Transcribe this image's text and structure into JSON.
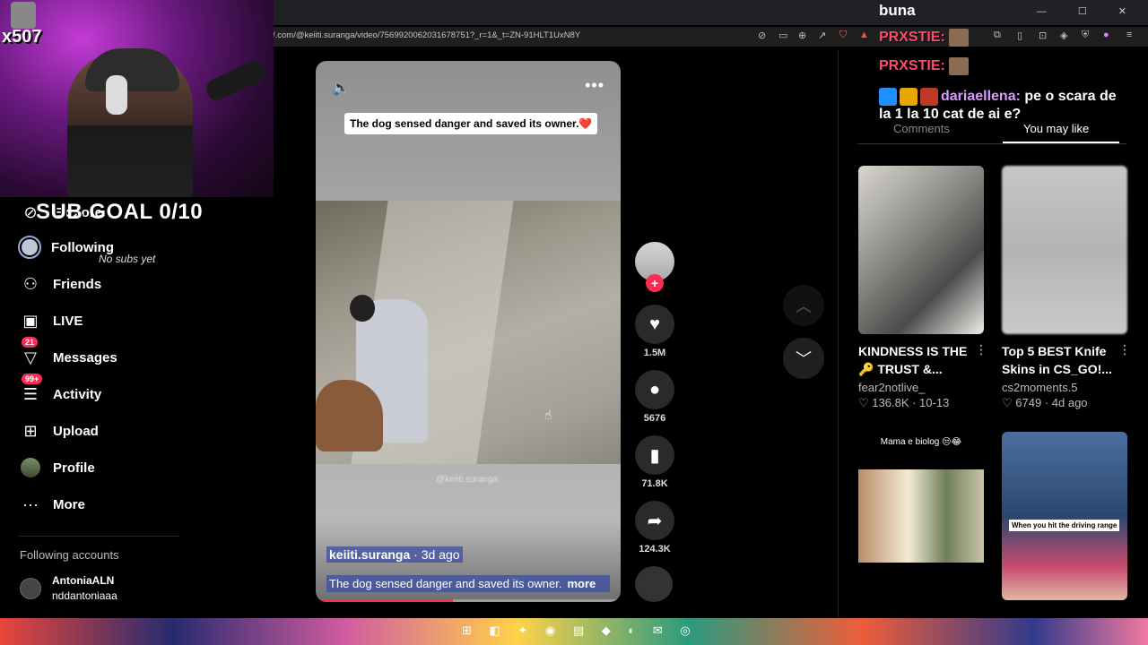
{
  "window": {
    "title": "buna",
    "controls": "— ☐ ✕"
  },
  "browser": {
    "url": "/.com/@keiiti.suranga/video/7569920062031678751?_r=1&_t=ZN-91HLT1UxN8Y"
  },
  "stream": {
    "viewer_badge": "x507",
    "sub_goal": "SUB GOAL 0/10",
    "no_subs": "No subs yet"
  },
  "sidebar": {
    "items": [
      {
        "label": "Explore",
        "icon": "compass-icon"
      },
      {
        "label": "Following",
        "icon": "following-icon"
      },
      {
        "label": "Friends",
        "icon": "friends-icon"
      },
      {
        "label": "LIVE",
        "icon": "live-icon"
      },
      {
        "label": "Messages",
        "icon": "messages-icon",
        "badge": "21"
      },
      {
        "label": "Activity",
        "icon": "activity-icon",
        "badge": "99+"
      },
      {
        "label": "Upload",
        "icon": "upload-icon"
      },
      {
        "label": "Profile",
        "icon": "profile-icon"
      },
      {
        "label": "More",
        "icon": "more-icon"
      }
    ],
    "following_header": "Following accounts",
    "account": {
      "name": "AntoniaALN",
      "handle": "nddantoniaaa"
    }
  },
  "video": {
    "overlay_caption": "The dog sensed danger and saved its owner.❤️",
    "watermark": "@keiiti.suranga",
    "author": "keiiti.suranga",
    "posted": " · 3d ago",
    "caption": "The dog sensed danger and saved its owner.",
    "more": "more",
    "progress": 0.45
  },
  "actions": {
    "likes": "1.5M",
    "comments": "5676",
    "saves": "71.8K",
    "shares": "124.3K"
  },
  "panel": {
    "tab_comments": "Comments",
    "tab_may_like": "You may like",
    "cards": [
      {
        "title": "KINDNESS IS THE 🔑 TRUST &...",
        "author": "fear2notlive_",
        "likes": "136.8K",
        "date": "10-13"
      },
      {
        "title": "Top 5 BEST Knife Skins in CS_GO!...",
        "author": "cs2moments.5",
        "likes": "6749",
        "date": "4d ago"
      },
      {
        "thumb_text": "Mama e biolog 😒😂"
      },
      {
        "thumb_text": "When you hit the driving range"
      }
    ]
  },
  "chat": {
    "line1_user": "PRXSTIE:",
    "line2_user": "PRXSTIE:",
    "line3_user": "dariaellena:",
    "line3_text": " pe o scara de la 1 la 10 cat de ai e?"
  },
  "colors": {
    "accent": "#fe2c55",
    "background": "#000000"
  }
}
